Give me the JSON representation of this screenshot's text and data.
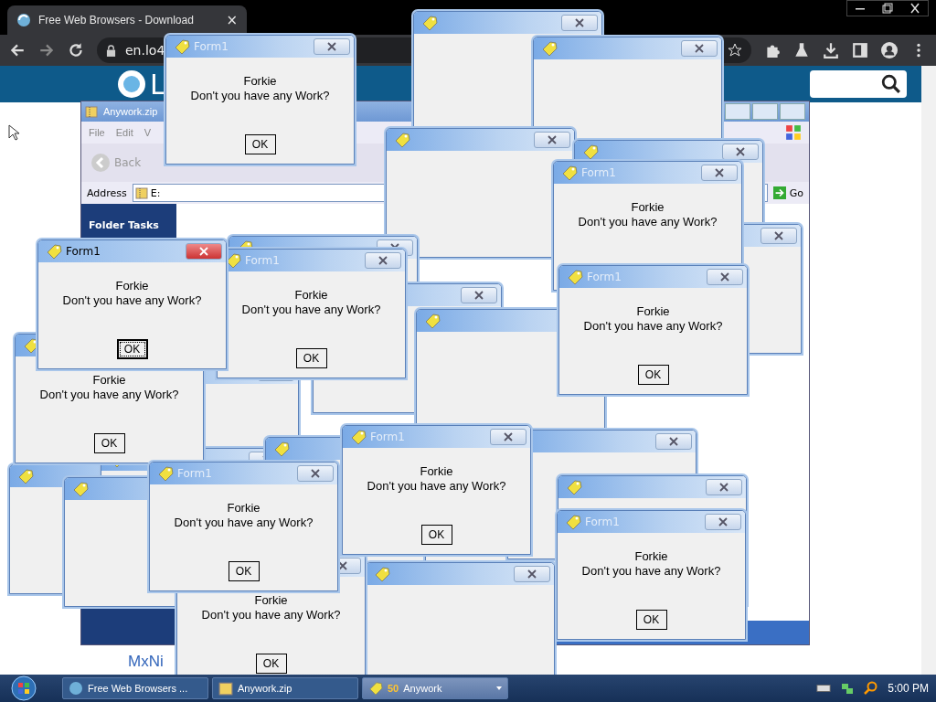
{
  "browser": {
    "tab": {
      "title": "Free Web Browsers - Download",
      "close": "×"
    },
    "address": "en.lo4",
    "site": {
      "logo_text": "L",
      "footer_text": "MxNi"
    }
  },
  "explorer": {
    "title": "Anywork.zip",
    "menu": [
      "File",
      "Edit",
      "V"
    ],
    "back": "Back",
    "address_label": "Address",
    "address_value": "E:",
    "go": "Go",
    "pane_title": "Folder Tasks"
  },
  "dialogs": [
    {
      "title": "Form1",
      "heading": "Forkie",
      "message": "Don't you have any Work?",
      "button": "OK",
      "active": false
    },
    {
      "title": "Form1",
      "heading": "Forkie",
      "message": "Don't you have any Work?",
      "active": false
    },
    {
      "title": "Form1",
      "heading": "Forkie",
      "message": "Don't you have any Work?",
      "button": "OK",
      "active": true
    },
    {
      "title": "Form1",
      "heading": "Forkie",
      "message": "Don't you have any Work?",
      "button": "OK",
      "active": false
    },
    {
      "title": "Form1",
      "heading": "Forkie",
      "message": "Don't you have any Work?",
      "button": "OK",
      "active": false
    },
    {
      "heading": "Forkie",
      "message": "Don't you have any Work?",
      "button": "OK",
      "active": false
    },
    {
      "title": "Form1",
      "heading": "Forkie",
      "message": "Don't you have any Work?",
      "button": "OK",
      "active": false
    },
    {
      "title": "Form1",
      "heading": "Forkie",
      "message": "Don't you have any Work?",
      "button": "OK",
      "active": false
    },
    {
      "title": "Form1",
      "heading": "Forkie",
      "message": "Don't you have any Work?",
      "button": "OK",
      "active": false
    },
    {
      "heading": "Forkie",
      "message": "Don't you have any Work?",
      "button": "OK",
      "active": false
    }
  ],
  "taskbar": {
    "items": [
      {
        "label": "Free Web Browsers ...",
        "selected": false
      },
      {
        "label": "Anywork.zip",
        "selected": false
      },
      {
        "count": "50",
        "label": "Anywork",
        "selected": true
      }
    ],
    "clock": "5:00 PM"
  }
}
